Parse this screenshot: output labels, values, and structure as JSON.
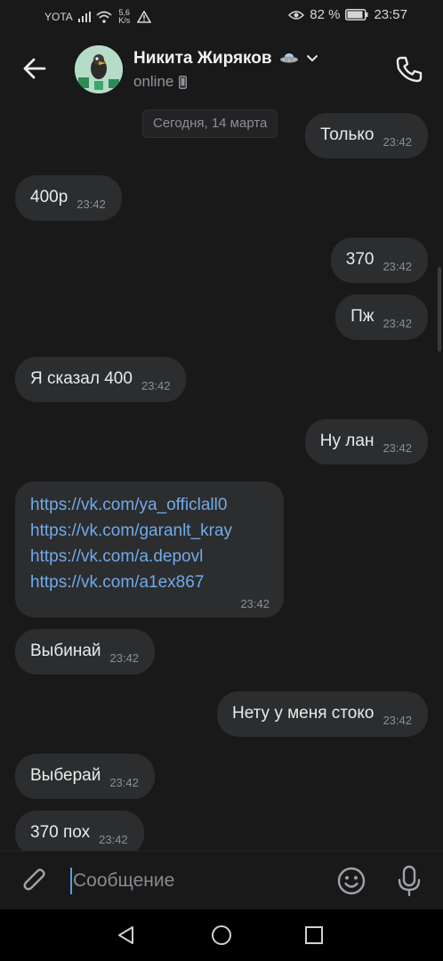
{
  "status_bar": {
    "carrier": "YOTA",
    "speed_value": "5,6",
    "speed_unit": "K/s",
    "battery_percent": "82 %",
    "time": "23:57"
  },
  "header": {
    "contact_name": "Никита Жиряков",
    "status": "online"
  },
  "chat": {
    "date_separator": "Сегодня, 14 марта",
    "messages": [
      {
        "direction": "outgoing",
        "text": "Только",
        "time": "23:42"
      },
      {
        "direction": "incoming",
        "text": "400р",
        "time": "23:42"
      },
      {
        "direction": "outgoing",
        "text": "370",
        "time": "23:42"
      },
      {
        "direction": "outgoing",
        "text": "Пж",
        "time": "23:42"
      },
      {
        "direction": "incoming",
        "text": "Я сказал 400",
        "time": "23:42"
      },
      {
        "direction": "outgoing",
        "text": "Ну лан",
        "time": "23:42"
      },
      {
        "direction": "incoming",
        "links": [
          "https://vk.com/ya_officlall0",
          "https://vk.com/garanlt_kray",
          "https://vk.com/a.depovl",
          "https://vk.com/a1ex867"
        ],
        "time": "23:42"
      },
      {
        "direction": "incoming",
        "text": "Выбинай",
        "time": "23:42"
      },
      {
        "direction": "outgoing",
        "text": "Нету у меня стоко",
        "time": "23:42"
      },
      {
        "direction": "incoming",
        "text": "Выберай",
        "time": "23:42"
      },
      {
        "direction": "incoming",
        "text": "370 пох",
        "time": "23:42"
      }
    ]
  },
  "composer": {
    "placeholder": "Сообщение"
  },
  "colors": {
    "background": "#19191a",
    "bubble": "#2c2d2e",
    "link": "#71aaeb",
    "time": "#8b9095"
  }
}
